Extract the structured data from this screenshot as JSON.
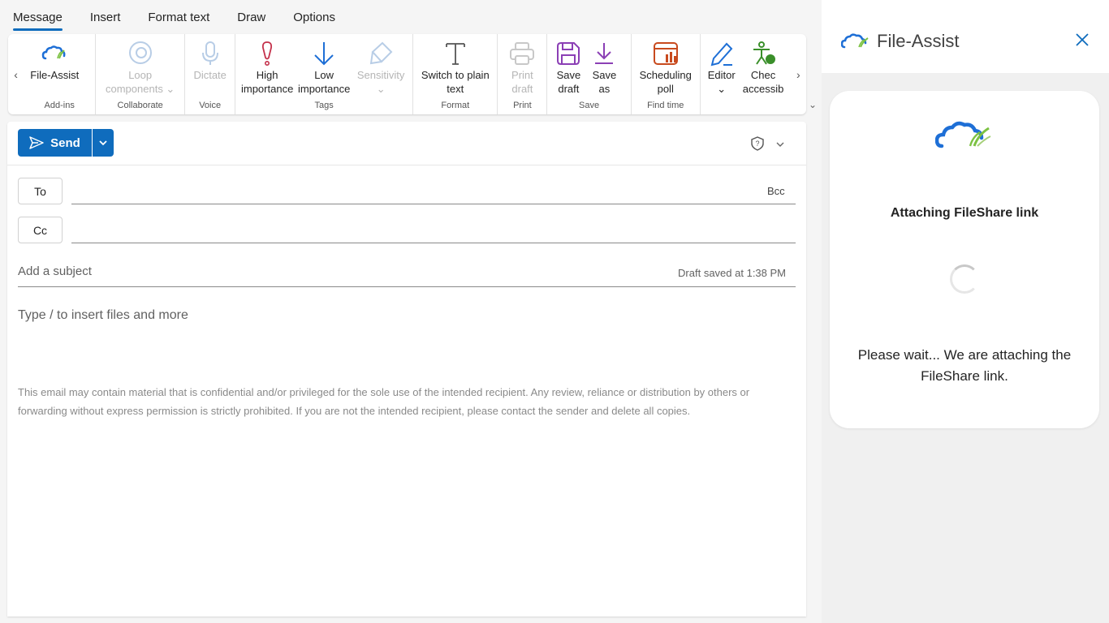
{
  "tabs": [
    "Message",
    "Insert",
    "Format text",
    "Draw",
    "Options"
  ],
  "ribbon": {
    "groups": [
      {
        "name": "Add-ins",
        "buttons": [
          {
            "label": "File-Assist",
            "icon": "file-assist-cloud-icon",
            "disabled": false
          }
        ]
      },
      {
        "name": "Collaborate",
        "buttons": [
          {
            "label": "Loop\ncomponents ⌄",
            "icon": "loop-icon",
            "disabled": true
          }
        ]
      },
      {
        "name": "Voice",
        "buttons": [
          {
            "label": "Dictate",
            "icon": "microphone-icon",
            "disabled": true
          }
        ]
      },
      {
        "name": "Tags",
        "buttons": [
          {
            "label": "High\nimportance",
            "icon": "high-importance-icon",
            "disabled": false
          },
          {
            "label": "Low\nimportance",
            "icon": "low-importance-icon",
            "disabled": false
          },
          {
            "label": "Sensitivity\n⌄",
            "icon": "sensitivity-icon",
            "disabled": true
          }
        ]
      },
      {
        "name": "Format",
        "buttons": [
          {
            "label": "Switch to plain\ntext",
            "icon": "plain-text-icon",
            "disabled": false
          }
        ]
      },
      {
        "name": "Print",
        "buttons": [
          {
            "label": "Print\ndraft",
            "icon": "printer-icon",
            "disabled": true
          }
        ]
      },
      {
        "name": "Save",
        "buttons": [
          {
            "label": "Save\ndraft",
            "icon": "save-icon",
            "disabled": false
          },
          {
            "label": "Save\nas",
            "icon": "download-icon",
            "disabled": false
          }
        ]
      },
      {
        "name": "Find time",
        "buttons": [
          {
            "label": "Scheduling\npoll",
            "icon": "scheduling-poll-icon",
            "disabled": false
          }
        ]
      },
      {
        "name": "",
        "buttons": [
          {
            "label": "Editor\n⌄",
            "icon": "editor-pen-icon",
            "disabled": false
          },
          {
            "label": "Chec\naccessib",
            "icon": "accessibility-icon",
            "disabled": false
          }
        ]
      }
    ]
  },
  "send": {
    "label": "Send"
  },
  "to": {
    "label": "To",
    "bcc": "Bcc"
  },
  "cc": {
    "label": "Cc"
  },
  "subject": {
    "placeholder": "Add a subject",
    "draft_status": "Draft saved at 1:38 PM"
  },
  "body": {
    "placeholder": "Type / to insert files and more",
    "disclaimer": "This email may contain material that is confidential and/or privileged for the sole use of the intended recipient. Any review, reliance or distribution by others or forwarding without express permission is strictly prohibited. If you are not the intended recipient, please contact the sender and delete all copies."
  },
  "panel": {
    "title": "File-Assist",
    "card_title": "Attaching FileShare link",
    "message": "Please wait... We are attaching the FileShare link."
  },
  "colors": {
    "accent": "#0f6cbd",
    "brand_blue": "#1e6fd6",
    "brand_green": "#7cc242"
  }
}
